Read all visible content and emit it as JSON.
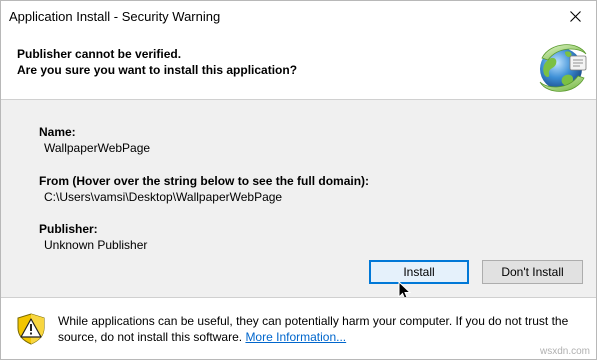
{
  "window": {
    "title": "Application Install - Security Warning"
  },
  "header": {
    "line1": "Publisher cannot be verified.",
    "line2": "Are you sure you want to install this application?"
  },
  "details": {
    "name_label": "Name:",
    "name_value": "WallpaperWebPage",
    "from_label": "From (Hover over the string below to see the full domain):",
    "from_value": "C:\\Users\\vamsi\\Desktop\\WallpaperWebPage",
    "publisher_label": "Publisher:",
    "publisher_value": "Unknown Publisher"
  },
  "buttons": {
    "install": "Install",
    "dont_install": "Don't Install"
  },
  "footer": {
    "warning_text": "While applications can be useful, they can potentially harm your computer. If you do not trust the source, do not install this software.",
    "link_text": "More Information..."
  },
  "watermark": "wsxdn.com",
  "icons": {
    "close": "close-icon",
    "globe": "globe-app-icon",
    "shield": "warning-shield-icon",
    "cursor": "mouse-cursor-icon"
  },
  "colors": {
    "accent": "#0078d7",
    "link": "#0066cc",
    "shield_yellow": "#f2c500"
  }
}
